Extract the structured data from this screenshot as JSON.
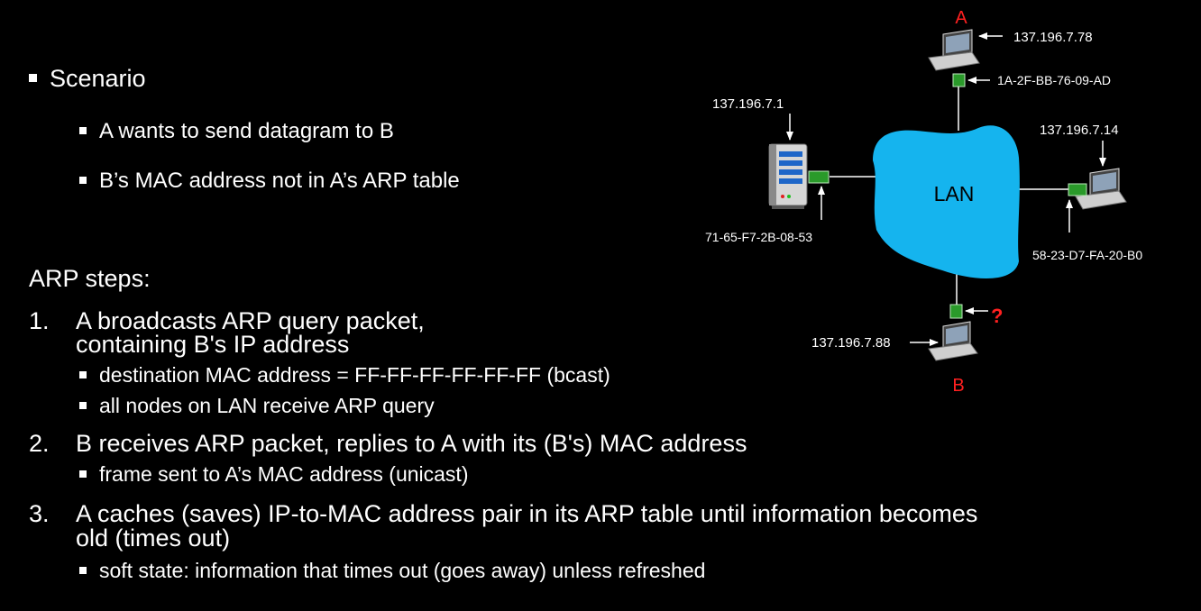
{
  "scenario": {
    "heading": "Scenario",
    "items": [
      "A wants to send datagram to B",
      "B’s MAC address not in A’s ARP table"
    ]
  },
  "steps": {
    "heading": "ARP steps:",
    "list": [
      {
        "num": "1.",
        "lines": [
          "A broadcasts ARP query packet,",
          "containing B's IP address"
        ],
        "subs": [
          "destination MAC address = FF-FF-FF-FF-FF-FF (bcast)",
          "all nodes on LAN receive ARP query"
        ]
      },
      {
        "num": "2.",
        "lines": [
          "B receives ARP packet, replies to A with its (B's) MAC address"
        ],
        "subs": [
          "frame sent to A’s MAC address (unicast)"
        ]
      },
      {
        "num": "3.",
        "lines": [
          "A caches (saves) IP-to-MAC address pair in its ARP table until information becomes",
          "old (times out)"
        ],
        "subs": [
          "soft state: information that times out (goes away) unless refreshed"
        ]
      }
    ]
  },
  "diagram": {
    "lan_label": "LAN",
    "node_a": {
      "name": "A",
      "ip": "137.196.7.78",
      "mac": "1A-2F-BB-76-09-AD"
    },
    "router": {
      "ip": "137.196.7.1",
      "mac": "71-65-F7-2B-08-53"
    },
    "node_right": {
      "ip": "137.196.7.14",
      "mac": "58-23-D7-FA-20-B0"
    },
    "node_b": {
      "name": "B",
      "ip": "137.196.7.88",
      "mac": "?"
    },
    "colors": {
      "lan": "#15b4ee",
      "label_red": "#ff2020",
      "adapter": "#2a9a2a"
    }
  }
}
